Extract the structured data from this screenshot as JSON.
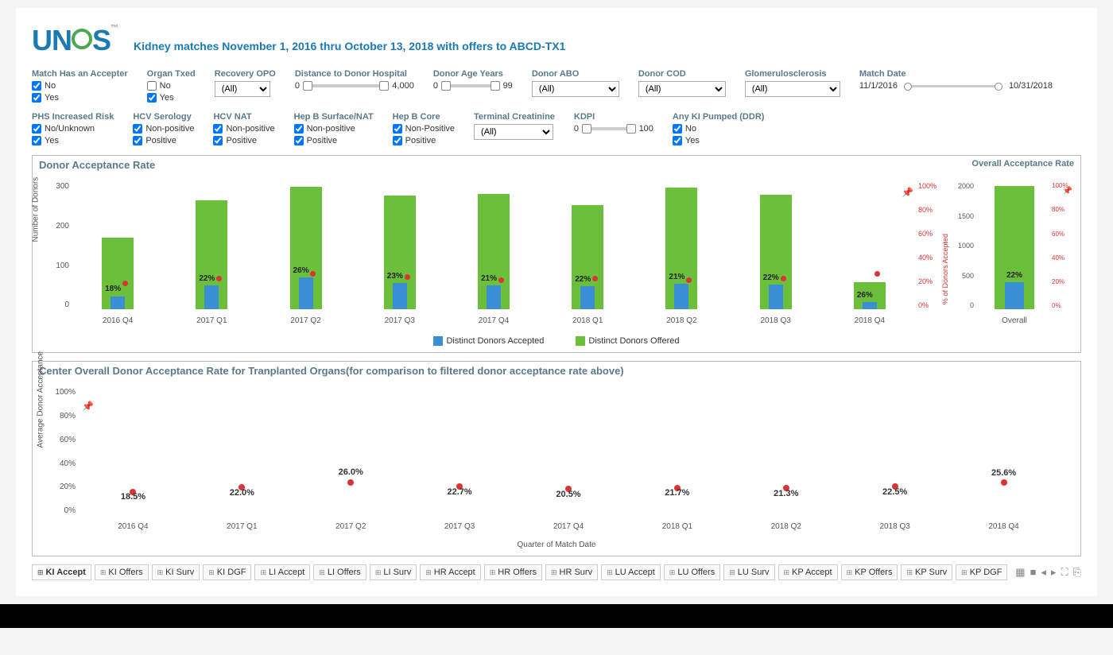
{
  "header": {
    "logo_text": "UNOS",
    "subtitle": "Kidney matches November 1, 2016 thru October 13, 2018  with offers to ABCD-TX1"
  },
  "filters_row1": {
    "match_accepter": {
      "label": "Match Has an Accepter",
      "opts": [
        {
          "t": "No",
          "c": true
        },
        {
          "t": "Yes",
          "c": true
        }
      ]
    },
    "organ_txed": {
      "label": "Organ Txed",
      "opts": [
        {
          "t": "No",
          "c": false
        },
        {
          "t": "Yes",
          "c": true
        }
      ]
    },
    "recovery_opo": {
      "label": "Recovery OPO",
      "value": "(All)"
    },
    "distance": {
      "label": "Distance to Donor Hospital",
      "min": "0",
      "max": "4,000"
    },
    "donor_age": {
      "label": "Donor Age Years",
      "min": "0",
      "max": "99"
    },
    "donor_abo": {
      "label": "Donor ABO",
      "value": "(All)"
    },
    "donor_cod": {
      "label": "Donor COD",
      "value": "(All)"
    },
    "glomer": {
      "label": "Glomerulosclerosis",
      "value": "(All)"
    },
    "match_date": {
      "label": "Match Date",
      "from": "11/1/2016",
      "to": "10/31/2018"
    }
  },
  "filters_row2": {
    "phs": {
      "label": "PHS Increased Risk",
      "opts": [
        {
          "t": "No/Unknown",
          "c": true
        },
        {
          "t": "Yes",
          "c": true
        }
      ]
    },
    "hcv_ser": {
      "label": "HCV Serology",
      "opts": [
        {
          "t": "Non-positive",
          "c": true
        },
        {
          "t": "Positive",
          "c": true
        }
      ]
    },
    "hcv_nat": {
      "label": "HCV NAT",
      "opts": [
        {
          "t": "Non-positive",
          "c": true
        },
        {
          "t": "Positive",
          "c": true
        }
      ]
    },
    "hepb_surf": {
      "label": "Hep B Surface/NAT",
      "opts": [
        {
          "t": "Non-positive",
          "c": true
        },
        {
          "t": "Positive",
          "c": true
        }
      ]
    },
    "hepb_core": {
      "label": "Hep B Core",
      "opts": [
        {
          "t": "Non-Positive",
          "c": true
        },
        {
          "t": "Positive",
          "c": true
        }
      ]
    },
    "term_creat": {
      "label": "Terminal Creatinine",
      "value": "(All)"
    },
    "kdpi": {
      "label": "KDPI",
      "min": "0",
      "max": "100"
    },
    "pumped": {
      "label": "Any KI Pumped (DDR)",
      "opts": [
        {
          "t": "No",
          "c": true
        },
        {
          "t": "Yes",
          "c": true
        }
      ]
    }
  },
  "panel1": {
    "title": "Donor Acceptance Rate",
    "overall_title": "Overall Acceptance Rate",
    "y_label": "Number of Donors",
    "y2_label": "% of Donors Accepted",
    "legend_acc": "Distinct Donors Accepted",
    "legend_off": "Distinct Donors Offered",
    "y_ticks": [
      "300",
      "200",
      "100",
      "0"
    ],
    "y2_ticks": [
      "100%",
      "80%",
      "60%",
      "40%",
      "20%",
      "0%"
    ],
    "overall_y_ticks": [
      "2000",
      "1500",
      "1000",
      "500",
      "0"
    ],
    "overall_label": "Overall"
  },
  "panel2": {
    "title": "Center Overall Donor Acceptance Rate for Tranplanted Organs(for comparison to filtered donor acceptance rate above)",
    "y_label": "Average Donor Acceptance",
    "x_label": "Quarter of Match Date",
    "y_ticks": [
      "100%",
      "80%",
      "60%",
      "40%",
      "20%",
      "0%"
    ]
  },
  "chart_data": [
    {
      "type": "bar",
      "title": "Donor Acceptance Rate",
      "categories": [
        "2016 Q4",
        "2017 Q1",
        "2017 Q2",
        "2017 Q3",
        "2017 Q4",
        "2018 Q1",
        "2018 Q2",
        "2018 Q3",
        "2018 Q4"
      ],
      "series": [
        {
          "name": "Distinct Donors Offered",
          "values": [
            170,
            258,
            290,
            268,
            272,
            246,
            288,
            270,
            65
          ]
        },
        {
          "name": "Distinct Donors Accepted",
          "values": [
            31,
            57,
            75,
            62,
            57,
            54,
            60,
            59,
            17
          ]
        }
      ],
      "pct_labels": [
        "18%",
        "22%",
        "26%",
        "23%",
        "21%",
        "22%",
        "21%",
        "22%",
        "26%"
      ],
      "ylim": [
        0,
        300
      ],
      "y2lim": [
        0,
        100
      ]
    },
    {
      "type": "bar",
      "title": "Overall Acceptance Rate",
      "categories": [
        "Overall"
      ],
      "series": [
        {
          "name": "Distinct Donors Offered",
          "values": [
            2130
          ]
        },
        {
          "name": "Distinct Donors Accepted",
          "values": [
            470
          ]
        }
      ],
      "pct_labels": [
        "22%"
      ],
      "ylim": [
        0,
        2200
      ]
    },
    {
      "type": "scatter",
      "title": "Center Overall Donor Acceptance Rate",
      "categories": [
        "2016 Q4",
        "2017 Q1",
        "2017 Q2",
        "2017 Q3",
        "2017 Q4",
        "2018 Q1",
        "2018 Q2",
        "2018 Q3",
        "2018 Q4"
      ],
      "values": [
        18.5,
        22.0,
        26.0,
        22.7,
        20.5,
        21.7,
        21.3,
        22.5,
        25.6
      ],
      "labels": [
        "18.5%",
        "22.0%",
        "26.0%",
        "22.7%",
        "20.5%",
        "21.7%",
        "21.3%",
        "22.5%",
        "25.6%"
      ],
      "ylim": [
        0,
        100
      ],
      "xlabel": "Quarter of Match Date",
      "ylabel": "Average Donor Acceptance"
    }
  ],
  "tabs": [
    "KI Accept",
    "KI Offers",
    "KI Surv",
    "KI DGF",
    "LI Accept",
    "LI Offers",
    "LI Surv",
    "HR Accept",
    "HR Offers",
    "HR Surv",
    "LU Accept",
    "LU Offers",
    "LU Surv",
    "KP Accept",
    "KP Offers",
    "KP Surv",
    "KP DGF"
  ],
  "active_tab": 0
}
